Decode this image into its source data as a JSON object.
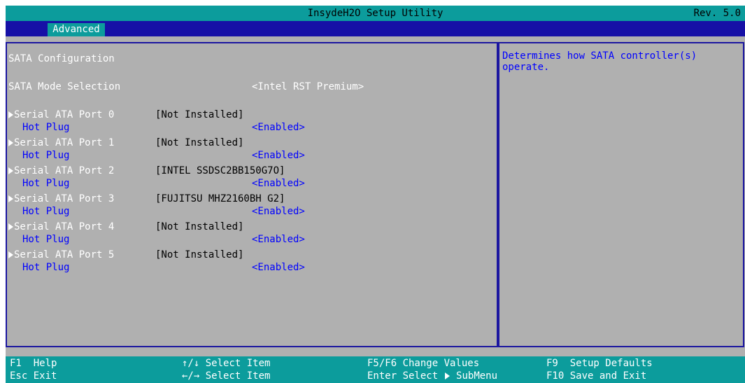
{
  "window": {
    "title": "InsydeH2O Setup Utility",
    "revision": "Rev. 5.0"
  },
  "tabs": [
    {
      "label": "Advanced",
      "selected": true
    }
  ],
  "main": {
    "section_title": "SATA Configuration",
    "mode_selection": {
      "label": "SATA Mode Selection",
      "value": "<Intel RST Premium>"
    },
    "ports": [
      {
        "label": "Serial ATA Port 0",
        "device": "[Not Installed]",
        "hot_plug_label": "Hot Plug",
        "hot_plug_value": "<Enabled>"
      },
      {
        "label": "Serial ATA Port 1",
        "device": "[Not Installed]",
        "hot_plug_label": "Hot Plug",
        "hot_plug_value": "<Enabled>"
      },
      {
        "label": "Serial ATA Port 2",
        "device": "[INTEL SSDSC2BB150G7O]",
        "hot_plug_label": "Hot Plug",
        "hot_plug_value": "<Enabled>"
      },
      {
        "label": "Serial ATA Port 3",
        "device": "[FUJITSU MHZ2160BH G2]",
        "hot_plug_label": "Hot Plug",
        "hot_plug_value": "<Enabled>"
      },
      {
        "label": "Serial ATA Port 4",
        "device": "[Not Installed]",
        "hot_plug_label": "Hot Plug",
        "hot_plug_value": "<Enabled>"
      },
      {
        "label": "Serial ATA Port 5",
        "device": "[Not Installed]",
        "hot_plug_label": "Hot Plug",
        "hot_plug_value": "<Enabled>"
      }
    ]
  },
  "help": {
    "text": "Determines how SATA controller(s) operate."
  },
  "footer": {
    "help": "F1  Help",
    "exit": "Esc Exit",
    "select_item_updown": "↑/↓ Select Item",
    "select_item_leftright": "←/→ Select Item",
    "change_values": "F5/F6 Change Values",
    "enter_select": "Enter Select",
    "submenu": "SubMenu",
    "setup_defaults": "F9  Setup Defaults",
    "save_exit": "F10 Save and Exit"
  },
  "colors": {
    "title_bar": "#0c9c9c",
    "tab_bar": "#1610a6",
    "panel_bg": "#b0b0b0",
    "border": "#1b16a0",
    "selectable_text": "#0000ff"
  },
  "icons": {
    "submenu_arrow": "right-triangle-icon"
  }
}
